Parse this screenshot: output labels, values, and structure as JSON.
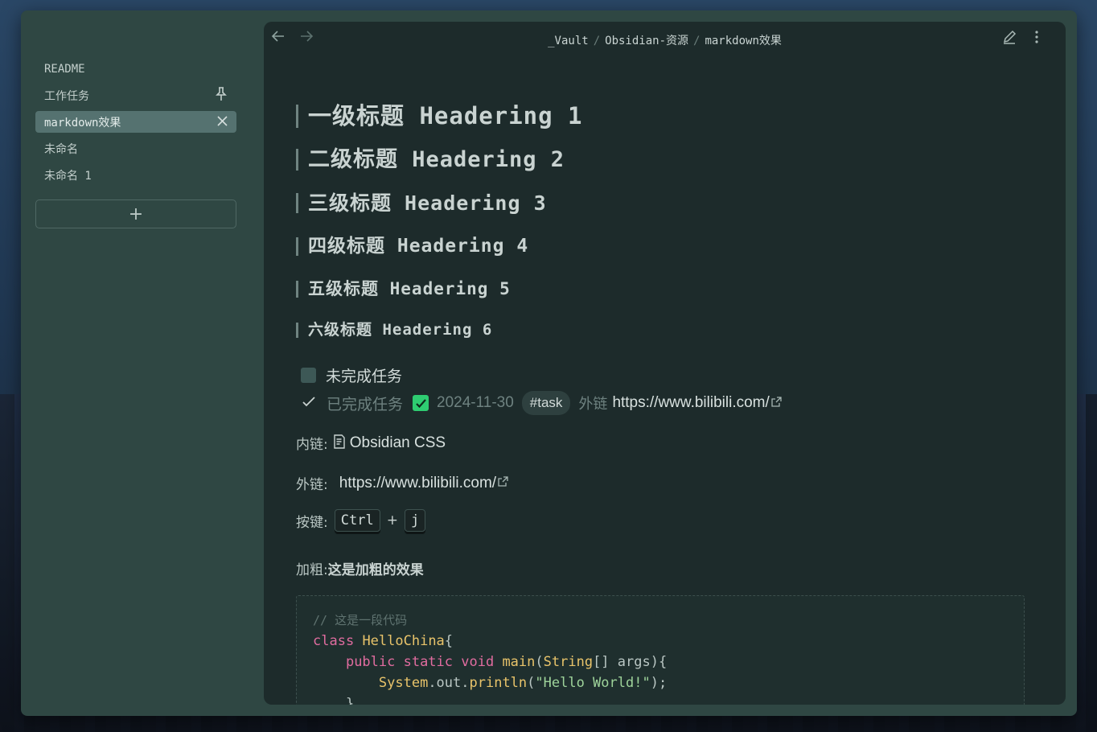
{
  "sidebar": {
    "items": [
      {
        "label": "README"
      },
      {
        "label": "工作任务"
      },
      {
        "label": "markdown效果"
      },
      {
        "label": "未命名"
      },
      {
        "label": "未命名 1"
      }
    ],
    "add_label": "+"
  },
  "topbar": {
    "breadcrumb": [
      "_Vault",
      "Obsidian-资源",
      "markdown效果"
    ],
    "separator": "/"
  },
  "headings": [
    "一级标题 Headering 1",
    "二级标题 Headering 2",
    "三级标题 Headering 3",
    "四级标题 Headering 4",
    "五级标题 Headering 5",
    "六级标题 Headering 6"
  ],
  "tasks": {
    "todo": "未完成任务",
    "done": "已完成任务",
    "date": "2024-11-30",
    "tag": "#task",
    "ext_label": "外链",
    "ext_url": "https://www.bilibili.com/"
  },
  "rows": {
    "internal_label": "内链:",
    "internal_link": "Obsidian CSS",
    "external_label": "外链:",
    "external_link": "https://www.bilibili.com/",
    "keys_label": "按键:",
    "key1": "Ctrl",
    "key_plus": "+",
    "key2": "j",
    "bold_label": "加粗:",
    "bold_text": "这是加粗的效果"
  },
  "code": {
    "comment": "// 这是一段代码",
    "line_class_kw": "class",
    "line_class_name": "HelloChina",
    "line_class_brace": "{",
    "line2_kw": "public static void",
    "line2_fn": "main",
    "line2_open": "(",
    "line2_type": "String",
    "line2_rest": "[] args){",
    "line3_obj": "System",
    "line3_mid": ".out.",
    "line3_fn": "println",
    "line3_open": "(",
    "line3_str": "\"Hello World!\"",
    "line3_close": ");",
    "line4": "}"
  }
}
